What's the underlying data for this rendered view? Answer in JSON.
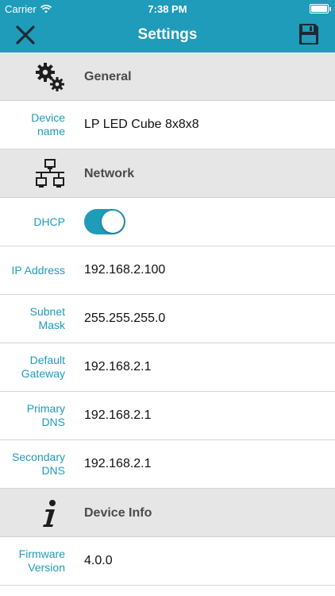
{
  "status_bar": {
    "carrier": "Carrier",
    "time": "7:38 PM"
  },
  "nav": {
    "title": "Settings",
    "close_icon": "close-icon",
    "save_icon": "floppy-save-icon"
  },
  "colors": {
    "accent": "#1e9cba",
    "section_bg": "#e6e6e6",
    "value_text": "#111111"
  },
  "sections": {
    "general": {
      "label": "General",
      "icon": "gears-icon"
    },
    "network": {
      "label": "Network",
      "icon": "network-icon"
    },
    "device_info": {
      "label": "Device Info",
      "icon": "info-icon"
    }
  },
  "rows": {
    "device_name": {
      "label": "Device\nname",
      "value": "LP LED Cube 8x8x8"
    },
    "dhcp": {
      "label": "DHCP",
      "enabled": true
    },
    "ip_address": {
      "label": "IP Address",
      "value": "192.168.2.100"
    },
    "subnet_mask": {
      "label": "Subnet\nMask",
      "value": "255.255.255.0"
    },
    "default_gateway": {
      "label": "Default\nGateway",
      "value": "192.168.2.1"
    },
    "primary_dns": {
      "label": "Primary\nDNS",
      "value": "192.168.2.1"
    },
    "secondary_dns": {
      "label": "Secondary\nDNS",
      "value": "192.168.2.1"
    },
    "firmware_version": {
      "label": "Firmware\nVersion",
      "value": "4.0.0"
    }
  }
}
